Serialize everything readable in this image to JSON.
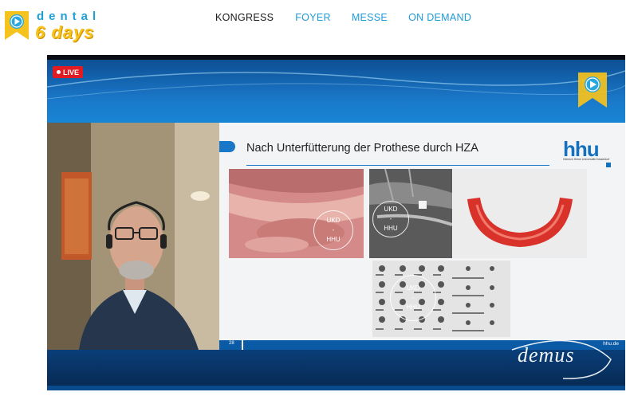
{
  "logo": {
    "line1": "dental",
    "line2": "6 days"
  },
  "nav": {
    "items": [
      {
        "label": "KONGRESS",
        "active": true
      },
      {
        "label": "FOYER",
        "active": false
      },
      {
        "label": "MESSE",
        "active": false
      },
      {
        "label": "ON DEMAND",
        "active": false
      }
    ]
  },
  "player": {
    "live_label": "LIVE",
    "watermark": "demus"
  },
  "slide": {
    "title": "Nach Unterfütterung der Prothese durch HZA",
    "logo_text": "hhu",
    "logo_subtext": "Heinrich Heine Universität Düsseldorf",
    "image_watermark_top": "UKD",
    "image_watermark_sep": "-",
    "image_watermark_bottom": "HHU",
    "page_number": "28",
    "footer_url": "hhu.de"
  },
  "colors": {
    "brand_blue": "#1f9ad8",
    "brand_yellow": "#f6c21c",
    "live_red": "#e11b22",
    "hhu_blue": "#1570be"
  }
}
